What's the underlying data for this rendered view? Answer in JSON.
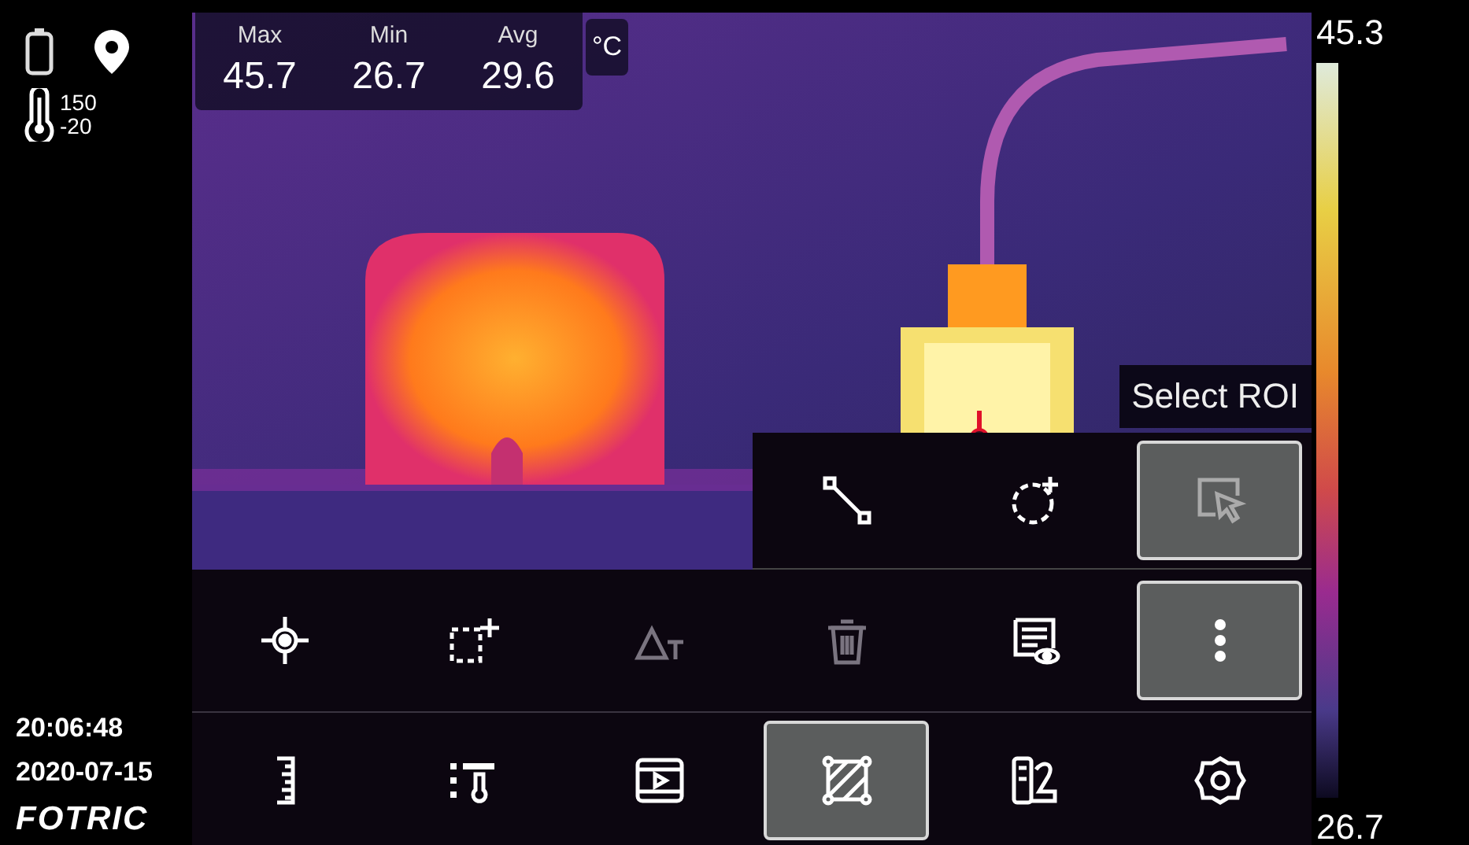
{
  "status": {
    "range_high": "150",
    "range_low": "-20"
  },
  "stats": [
    {
      "label": "Max",
      "value": "45.7"
    },
    {
      "label": "Min",
      "value": "26.7"
    },
    {
      "label": "Avg",
      "value": "29.6"
    }
  ],
  "unit": "°C",
  "scale": {
    "max": "45.3",
    "min": "26.7"
  },
  "clock": {
    "time": "20:06:48",
    "date": "2020-07-15"
  },
  "brand": "FOTRIC",
  "tooltip": "Select ROI",
  "popup_tools": [
    {
      "kind": "line",
      "selected": false
    },
    {
      "kind": "circle",
      "selected": false
    },
    {
      "kind": "select",
      "selected": true
    }
  ],
  "toolbar_top": [
    {
      "kind": "spot",
      "selected": false,
      "disabled": false
    },
    {
      "kind": "rect",
      "selected": false,
      "disabled": false
    },
    {
      "kind": "delta",
      "selected": false,
      "disabled": true
    },
    {
      "kind": "delete",
      "selected": false,
      "disabled": true
    },
    {
      "kind": "view",
      "selected": false,
      "disabled": false
    },
    {
      "kind": "more",
      "selected": true,
      "disabled": false
    }
  ],
  "toolbar_bottom": [
    {
      "kind": "ruler",
      "selected": false
    },
    {
      "kind": "thermo",
      "selected": false
    },
    {
      "kind": "video",
      "selected": false
    },
    {
      "kind": "area",
      "selected": true
    },
    {
      "kind": "palette",
      "selected": false
    },
    {
      "kind": "settings",
      "selected": false
    }
  ]
}
